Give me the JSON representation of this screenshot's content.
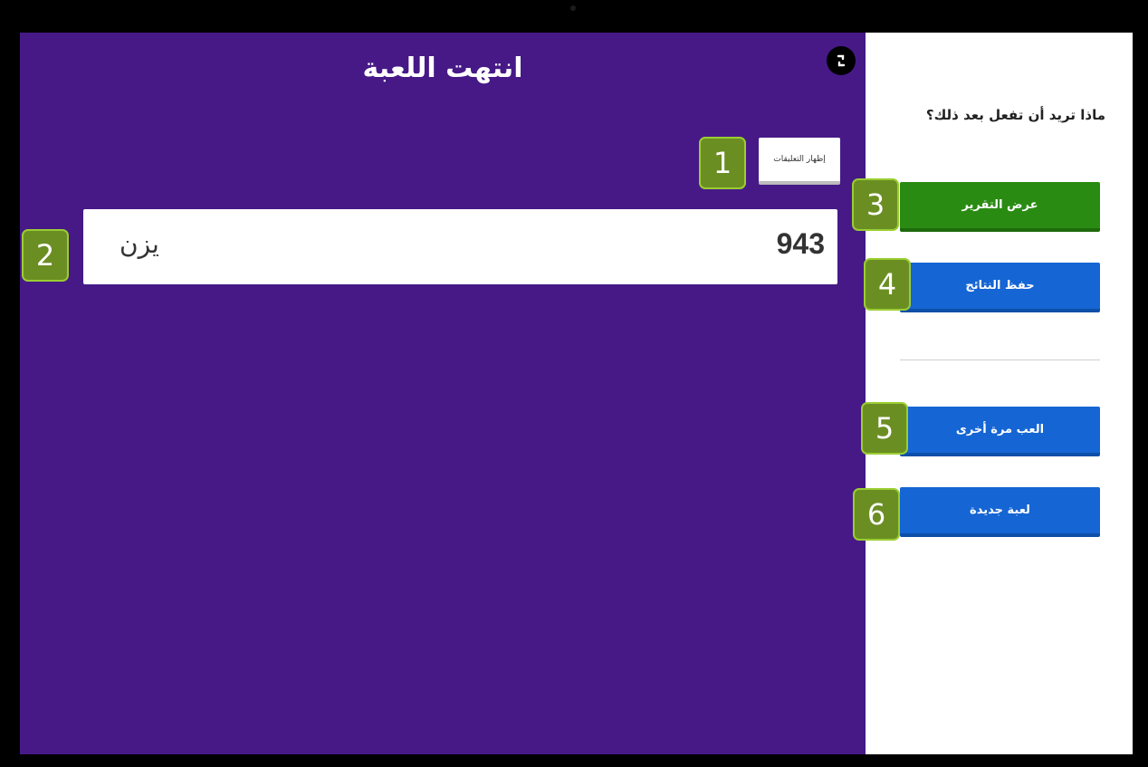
{
  "game": {
    "title": "انتهت اللعبة",
    "show_comments_label": "إظهار التعليقات",
    "result": {
      "score": "943",
      "player_name": "يزن"
    }
  },
  "sidebar": {
    "question": "ماذا تريد أن تفعل بعد ذلك؟",
    "buttons": {
      "view_report": "عرض التقرير",
      "save_results": "حفظ النتائج",
      "play_again": "العب مرة أخرى",
      "new_game": "لعبة جديدة"
    }
  },
  "badges": [
    "1",
    "2",
    "3",
    "4",
    "5",
    "6"
  ],
  "icons": {
    "fullscreen": "expand-icon"
  },
  "colors": {
    "game_background": "#461987",
    "green_button": "#2a8b12",
    "blue_button": "#1565d4",
    "badge": "#6b8e23"
  }
}
